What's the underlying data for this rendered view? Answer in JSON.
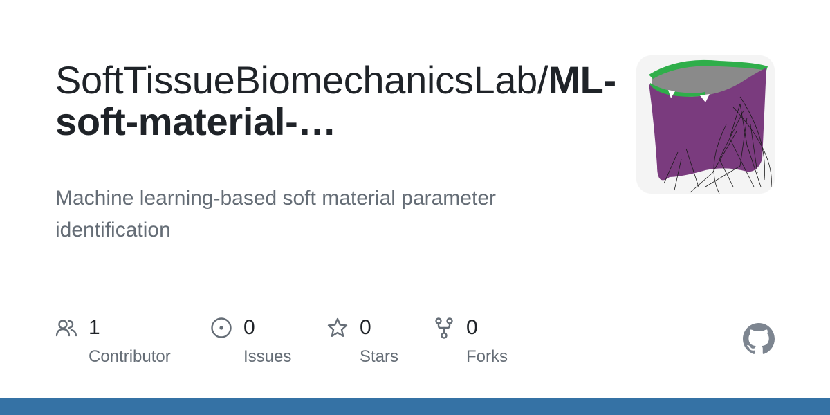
{
  "repo": {
    "owner": "SoftTissueBiomechanicsLab",
    "separator": "/",
    "name": "ML-soft-material-…",
    "description": "Machine learning-based soft material parameter identification"
  },
  "stats": [
    {
      "icon": "contributors-icon",
      "value": "1",
      "label": "Contributor"
    },
    {
      "icon": "issues-icon",
      "value": "0",
      "label": "Issues"
    },
    {
      "icon": "star-icon",
      "value": "0",
      "label": "Stars"
    },
    {
      "icon": "fork-icon",
      "value": "0",
      "label": "Forks"
    }
  ],
  "colors": {
    "text_primary": "#1f2328",
    "text_secondary": "#656d76",
    "language_bar": "#3572a5",
    "avatar_mesh_purple": "#7a3b7e",
    "avatar_mesh_green": "#2fae4a"
  },
  "icons": {
    "brand": "github-mark-icon",
    "avatar": "repo-avatar-image"
  }
}
